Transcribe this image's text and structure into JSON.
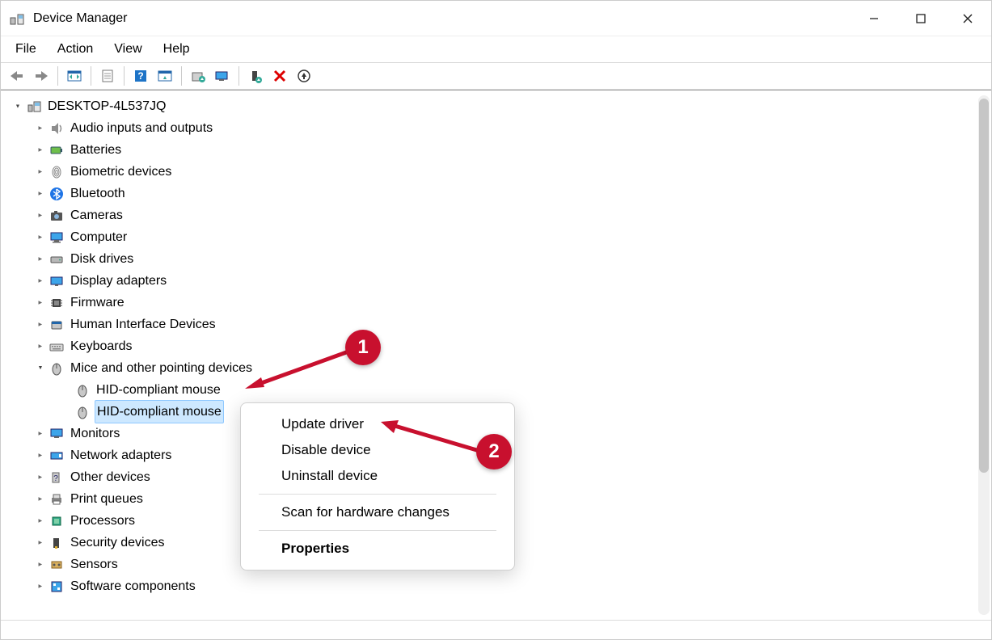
{
  "window": {
    "title": "Device Manager"
  },
  "menubar": [
    "File",
    "Action",
    "View",
    "Help"
  ],
  "tree": {
    "root": "DESKTOP-4L537JQ",
    "categories": [
      "Audio inputs and outputs",
      "Batteries",
      "Biometric devices",
      "Bluetooth",
      "Cameras",
      "Computer",
      "Disk drives",
      "Display adapters",
      "Firmware",
      "Human Interface Devices",
      "Keyboards",
      "Mice and other pointing devices",
      "Monitors",
      "Network adapters",
      "Other devices",
      "Print queues",
      "Processors",
      "Security devices",
      "Sensors",
      "Software components"
    ],
    "expanded_category_children": [
      "HID-compliant mouse",
      "HID-compliant mouse"
    ]
  },
  "context_menu": {
    "items": [
      "Update driver",
      "Disable device",
      "Uninstall device"
    ],
    "scan": "Scan for hardware changes",
    "properties": "Properties"
  },
  "annotations": {
    "badge1": "1",
    "badge2": "2"
  },
  "colors": {
    "accent_red": "#c8102e",
    "selection": "#cde8ff"
  }
}
